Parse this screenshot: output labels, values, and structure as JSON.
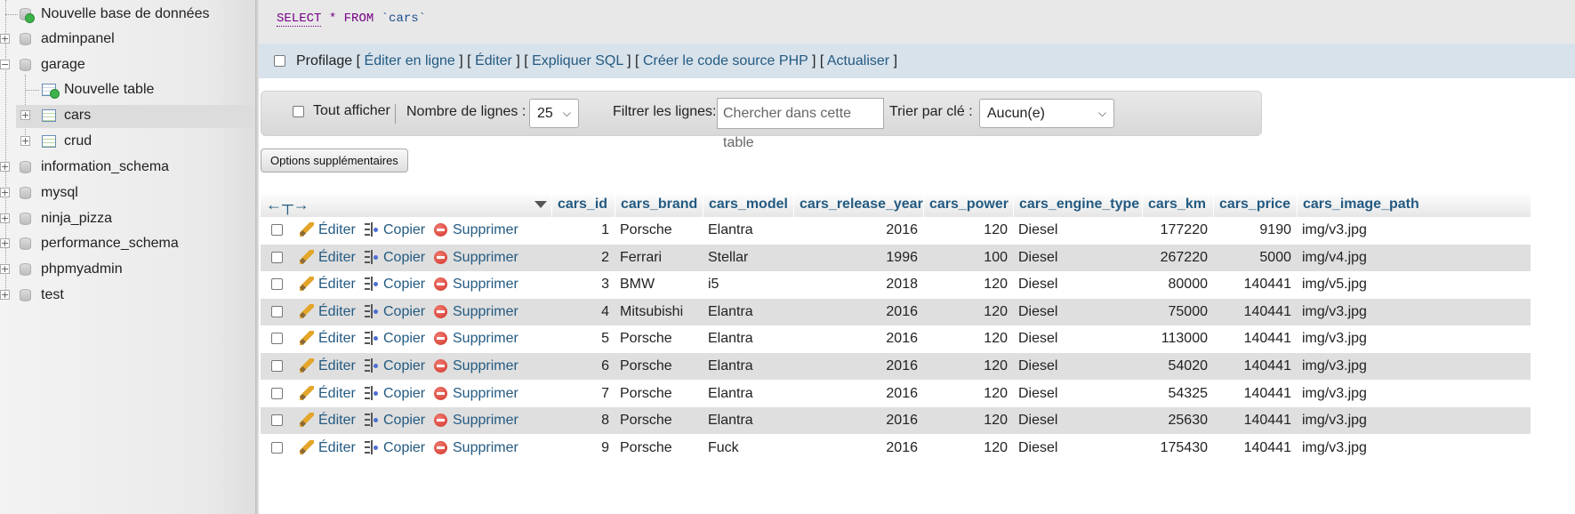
{
  "nav_tree": {
    "items": [
      {
        "label": "Nouvelle base de données"
      },
      {
        "label": "adminpanel"
      },
      {
        "label": "garage"
      },
      {
        "label": "Nouvelle table"
      },
      {
        "label": "cars"
      },
      {
        "label": "crud"
      },
      {
        "label": "information_schema"
      },
      {
        "label": "mysql"
      },
      {
        "label": "ninja_pizza"
      },
      {
        "label": "performance_schema"
      },
      {
        "label": "phpmyadmin"
      },
      {
        "label": "test"
      }
    ]
  },
  "sql_query": {
    "select": "SELECT",
    "star": "*",
    "from": "FROM",
    "table": "`cars`"
  },
  "profiling_bar": {
    "profilage_label": "Profilage",
    "links": [
      "Éditer en ligne",
      "Éditer",
      "Expliquer SQL",
      "Créer le code source PHP",
      "Actualiser"
    ],
    "bracket_open": "[",
    "bracket_close": "]",
    "separator": "] ["
  },
  "navigation": {
    "show_all_label": "Tout afficher",
    "rows_label": "Nombre de lignes :",
    "rows_value": "25",
    "filter_label": "Filtrer les lignes:",
    "filter_placeholder": "Chercher dans cette table",
    "sort_label": "Trier par clé :",
    "sort_value": "Aucun(e)"
  },
  "options_button": "Options supplémentaires",
  "table": {
    "columns": [
      "cars_id",
      "cars_brand",
      "cars_model",
      "cars_release_year",
      "cars_power",
      "cars_engine_type",
      "cars_km",
      "cars_price",
      "cars_image_path"
    ],
    "actions": {
      "edit": "Éditer",
      "copy": "Copier",
      "delete": "Supprimer"
    },
    "rows": [
      [
        "1",
        "Porsche",
        "Elantra",
        "2016",
        "120",
        "Diesel",
        "177220",
        "9190",
        "img/v3.jpg"
      ],
      [
        "2",
        "Ferrari",
        "Stellar",
        "1996",
        "100",
        "Diesel",
        "267220",
        "5000",
        "img/v4.jpg"
      ],
      [
        "3",
        "BMW",
        "i5",
        "2018",
        "120",
        "Diesel",
        "80000",
        "140441",
        "img/v5.jpg"
      ],
      [
        "4",
        "Mitsubishi",
        "Elantra",
        "2016",
        "120",
        "Diesel",
        "75000",
        "140441",
        "img/v3.jpg"
      ],
      [
        "5",
        "Porsche",
        "Elantra",
        "2016",
        "120",
        "Diesel",
        "113000",
        "140441",
        "img/v3.jpg"
      ],
      [
        "6",
        "Porsche",
        "Elantra",
        "2016",
        "120",
        "Diesel",
        "54020",
        "140441",
        "img/v3.jpg"
      ],
      [
        "7",
        "Porsche",
        "Elantra",
        "2016",
        "120",
        "Diesel",
        "54325",
        "140441",
        "img/v3.jpg"
      ],
      [
        "8",
        "Porsche",
        "Elantra",
        "2016",
        "120",
        "Diesel",
        "25630",
        "140441",
        "img/v3.jpg"
      ],
      [
        "9",
        "Porsche",
        "Fuck",
        "2016",
        "120",
        "Diesel",
        "175430",
        "140441",
        "img/v3.jpg"
      ]
    ]
  },
  "colors": {
    "link": "#235a81",
    "row_even": "#dfdfdf",
    "sql_keyword": "#770088"
  }
}
